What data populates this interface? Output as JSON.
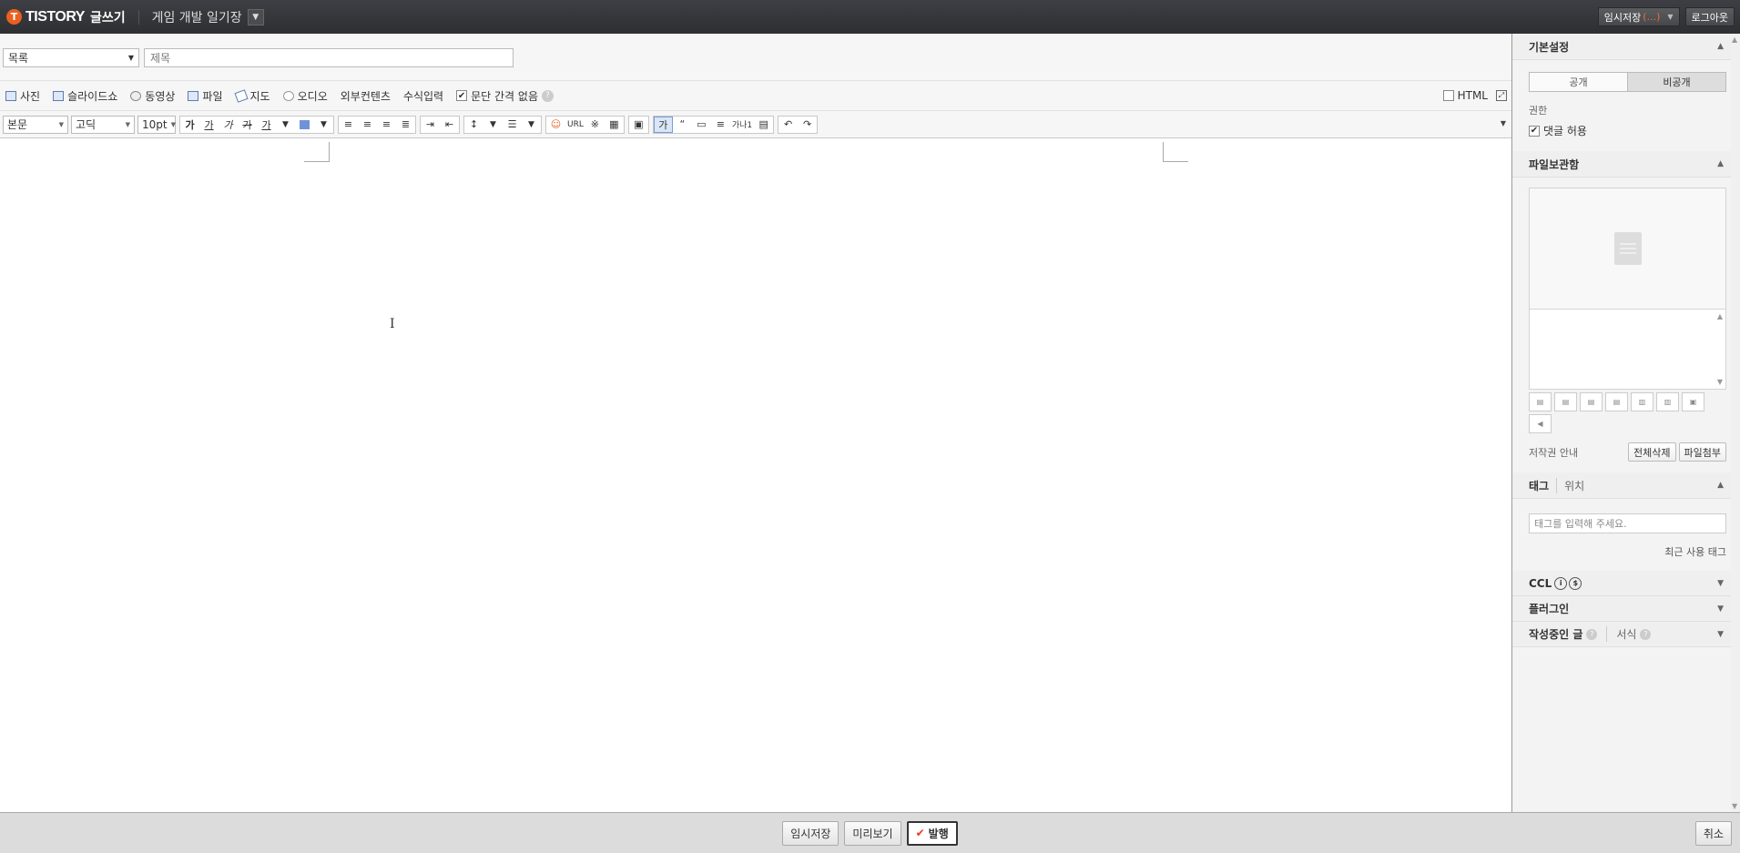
{
  "topbar": {
    "logo_text": "TISTORY",
    "logo_mark": "T",
    "sub_title": "글쓰기",
    "blog_name": "게임 개발 일기장",
    "temp_save_label": "임시저장",
    "temp_save_count": "(...)",
    "logout_label": "로그아웃"
  },
  "editor": {
    "category_value": "목록",
    "title_placeholder": "제목",
    "attachments": [
      {
        "label": "사진",
        "icon": "photo-icon"
      },
      {
        "label": "슬라이드쇼",
        "icon": "slideshow-icon"
      },
      {
        "label": "동영상",
        "icon": "video-icon"
      },
      {
        "label": "파일",
        "icon": "file-icon"
      },
      {
        "label": "지도",
        "icon": "map-icon"
      },
      {
        "label": "오디오",
        "icon": "audio-icon"
      },
      {
        "label": "외부컨텐츠",
        "icon": ""
      },
      {
        "label": "수식입력",
        "icon": ""
      }
    ],
    "paragraph_spacing_label": "문단 간격 없음",
    "html_label": "HTML",
    "format": {
      "style_value": "본문",
      "font_value": "고딕",
      "size_value": "10pt",
      "text_buttons": [
        "가",
        "가",
        "가",
        "가",
        "가"
      ],
      "url_label": "URL",
      "sup_label": "가나1"
    }
  },
  "sidebar": {
    "basic_settings": "기본설정",
    "public_label": "공개",
    "private_label": "비공개",
    "permission_label": "권한",
    "allow_comments_label": "댓글 허용",
    "file_storage": "파일보관함",
    "copyright_label": "저작권 안내",
    "delete_all_label": "전체삭제",
    "attach_file_label": "파일첨부",
    "tag_tab": "태그",
    "location_tab": "위치",
    "tag_placeholder": "태그를 입력해 주세요.",
    "recent_tags": "최근 사용 태그",
    "ccl_label": "CCL",
    "plugin_label": "플러그인",
    "drafts_label": "작성중인 글",
    "template_label": "서식"
  },
  "bottombar": {
    "temp_save": "임시저장",
    "preview": "미리보기",
    "publish": "발행",
    "cancel": "취소"
  }
}
